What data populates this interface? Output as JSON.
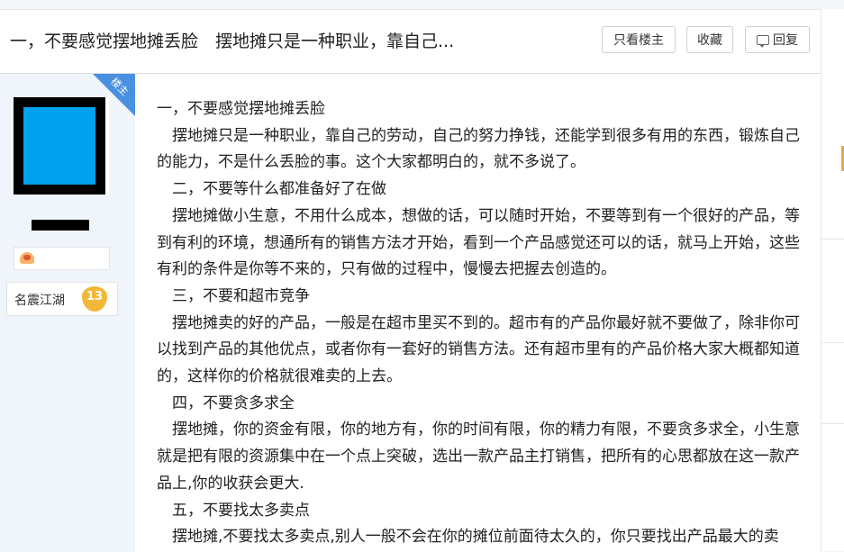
{
  "header": {
    "title": "一，不要感觉摆地摊丢脸　摆地摊只是一种职业，靠自己...",
    "btn_only_op": "只看楼主",
    "btn_fav": "收藏",
    "btn_reply": "回复"
  },
  "author": {
    "badge": "楼主",
    "rank_title": "名震江湖",
    "rank_level": "13"
  },
  "post": {
    "paragraphs": [
      "一，不要感觉摆地摊丢脸",
      "　摆地摊只是一种职业，靠自己的劳动，自己的努力挣钱，还能学到很多有用的东西，锻炼自己的能力，不是什么丢脸的事。这个大家都明白的，就不多说了。",
      "　二，不要等什么都准备好了在做",
      "　摆地摊做小生意，不用什么成本，想做的话，可以随时开始，不要等到有一个很好的产品，等到有利的环境，想通所有的销售方法才开始，看到一个产品感觉还可以的话，就马上开始，这些有利的条件是你等不来的，只有做的过程中，慢慢去把握去创造的。",
      "　三，不要和超市竞争",
      "　摆地摊卖的好的产品，一般是在超市里买不到的。超市有的产品你最好就不要做了，除非你可以找到产品的其他优点，或者你有一套好的销售方法。还有超市里有的产品价格大家大概都知道的，这样你的价格就很难卖的上去。",
      "　四，不要贪多求全",
      "　摆地摊，你的资金有限，你的地方有，你的时间有限，你的精力有限，不要贪多求全，小生意就是把有限的资源集中在一个点上突破，选出一款产品主打销售，把所有的心思都放在这一款产品上,你的收获会更大.",
      "　五，不要找太多卖点",
      "　摆地摊,不要找太多卖点,别人一般不会在你的摊位前面待太久的，你只要找出产品最大的卖"
    ]
  },
  "colors": {
    "badge": "#4a90e2",
    "avatar": "#00a2ee",
    "sidebar_bg": "#f0f5fc",
    "rank_shield": "#f2b736"
  },
  "icons": [
    "reply-icon",
    "level-icon",
    "rank-shield-icon"
  ]
}
